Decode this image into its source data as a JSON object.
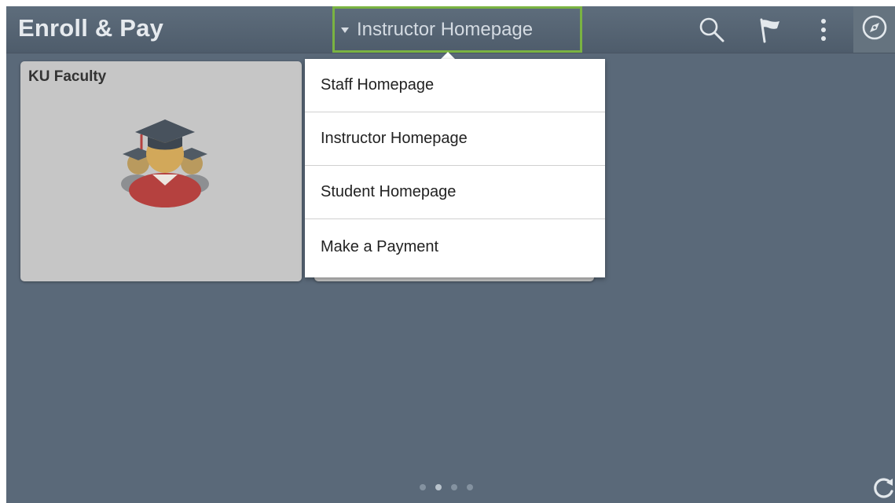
{
  "header": {
    "app_title": "Enroll & Pay",
    "homepage_selector": {
      "label": "Instructor Homepage",
      "icon": "caret-down-icon"
    },
    "actions": [
      {
        "name": "search",
        "icon": "search-icon"
      },
      {
        "name": "notifications",
        "icon": "flag-icon"
      },
      {
        "name": "actions-list",
        "icon": "more-vertical-icon"
      },
      {
        "name": "navigator",
        "icon": "compass-icon"
      }
    ]
  },
  "tiles": [
    {
      "title": "KU Faculty",
      "icon": "faculty-graduates-icon"
    }
  ],
  "dropdown": {
    "items": [
      {
        "label": "Staff Homepage"
      },
      {
        "label": "Instructor Homepage"
      },
      {
        "label": "Student Homepage"
      },
      {
        "label": "Make a Payment"
      }
    ]
  },
  "pager": {
    "page_count": 4,
    "active_page": 2
  },
  "footer": {
    "refresh_icon": "refresh-icon"
  },
  "colors": {
    "background": "#5a6979",
    "header": "#55636f",
    "highlight_border": "#7ab342",
    "tile": "#c6c6c6",
    "menu_bg": "#ffffff"
  }
}
